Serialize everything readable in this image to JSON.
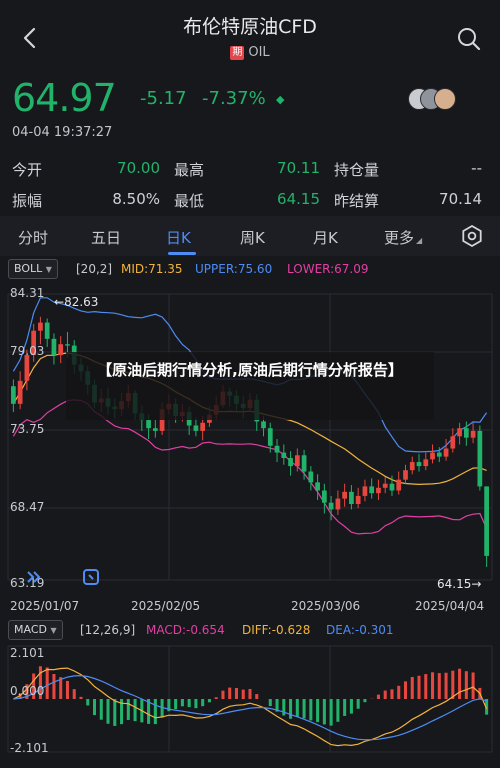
{
  "header": {
    "title": "布伦特原油CFD",
    "badge": "期",
    "subtitle": "OIL"
  },
  "quote": {
    "price": "64.97",
    "change": "-5.17",
    "change_pct": "-7.37%",
    "timestamp": "04-04 19:37:27"
  },
  "stats": [
    {
      "label": "今开",
      "value": "70.00",
      "color": "#21b36a"
    },
    {
      "label": "最高",
      "value": "70.11",
      "color": "#21b36a"
    },
    {
      "label": "持仓量",
      "value": "--",
      "color": "#cfd2d8"
    },
    {
      "label": "振幅",
      "value": "8.50%",
      "color": "#cfd2d8"
    },
    {
      "label": "最低",
      "value": "64.15",
      "color": "#21b36a"
    },
    {
      "label": "昨结算",
      "value": "70.14",
      "color": "#cfd2d8"
    }
  ],
  "tabs": [
    "分时",
    "五日",
    "日K",
    "周K",
    "月K",
    "更多"
  ],
  "boll": {
    "name": "BOLL",
    "params": "[20,2]",
    "mid": "MID:71.35",
    "upper": "UPPER:75.60",
    "lower": "LOWER:67.09"
  },
  "macd": {
    "name": "MACD",
    "params": "[12,26,9]",
    "macd": "MACD:-0.654",
    "diff": "DIFF:-0.628",
    "dea": "DEA:-0.301"
  },
  "price_axis": [
    "84.31",
    "79.03",
    "73.75",
    "68.47",
    "63.19"
  ],
  "macd_axis": [
    "2.101",
    "0.000",
    "-2.101"
  ],
  "price_marks": {
    "high": "82.63",
    "low": "64.15"
  },
  "dates": [
    "2025/01/07",
    "2025/02/05",
    "2025/03/06",
    "2025/04/04"
  ],
  "overlay_text": "【原油后期行情分析,原油后期行情分析报告】",
  "colors": {
    "up": "#e8473f",
    "down": "#21b36a",
    "mid": "#f2b33d",
    "upper": "#4d8cf5",
    "lower": "#e23fa4",
    "accent": "#4d8cf5"
  },
  "chart_data": {
    "type": "candlestick",
    "ylim": [
      63.19,
      84.31
    ],
    "candles": [
      [
        77.5,
        76.2,
        78.0,
        75.6
      ],
      [
        76.2,
        77.9,
        78.6,
        75.8
      ],
      [
        77.9,
        79.8,
        80.2,
        77.2
      ],
      [
        79.8,
        81.6,
        82.1,
        79.3
      ],
      [
        81.6,
        82.2,
        82.63,
        80.6
      ],
      [
        82.2,
        81.0,
        82.5,
        80.4
      ],
      [
        81.0,
        79.8,
        81.4,
        79.1
      ],
      [
        79.8,
        80.6,
        81.2,
        79.2
      ],
      [
        80.6,
        80.5,
        81.5,
        79.6
      ],
      [
        80.5,
        79.1,
        80.9,
        78.4
      ],
      [
        79.1,
        78.6,
        79.6,
        77.9
      ],
      [
        78.6,
        77.6,
        79.0,
        76.9
      ],
      [
        77.6,
        76.3,
        78.0,
        75.9
      ],
      [
        76.3,
        76.6,
        77.3,
        75.6
      ],
      [
        76.6,
        76.0,
        77.4,
        75.4
      ],
      [
        76.0,
        75.8,
        76.6,
        75.1
      ],
      [
        75.8,
        76.4,
        77.0,
        75.3
      ],
      [
        76.4,
        77.0,
        77.6,
        75.9
      ],
      [
        77.0,
        75.5,
        77.2,
        75.0
      ],
      [
        75.5,
        75.0,
        76.1,
        74.2
      ],
      [
        75.0,
        74.4,
        75.4,
        73.6
      ],
      [
        74.4,
        74.2,
        75.0,
        73.7
      ],
      [
        74.2,
        75.8,
        76.3,
        73.9
      ],
      [
        75.8,
        76.2,
        76.9,
        75.4
      ],
      [
        76.2,
        75.3,
        76.6,
        74.8
      ],
      [
        75.3,
        75.6,
        76.2,
        74.9
      ],
      [
        75.6,
        74.6,
        76.0,
        73.9
      ],
      [
        74.6,
        74.2,
        75.2,
        73.8
      ],
      [
        74.2,
        74.8,
        75.3,
        73.5
      ],
      [
        74.8,
        75.4,
        76.0,
        74.5
      ],
      [
        75.4,
        76.1,
        76.8,
        75.0
      ],
      [
        76.1,
        77.1,
        77.6,
        75.9
      ],
      [
        77.1,
        76.8,
        77.4,
        76.0
      ],
      [
        76.8,
        76.2,
        77.2,
        75.7
      ],
      [
        76.2,
        75.9,
        76.8,
        75.1
      ],
      [
        75.9,
        76.5,
        77.0,
        75.6
      ],
      [
        76.5,
        74.9,
        76.9,
        74.2
      ],
      [
        74.9,
        74.4,
        75.3,
        73.8
      ],
      [
        74.4,
        73.1,
        74.8,
        72.6
      ],
      [
        73.1,
        72.6,
        73.6,
        71.9
      ],
      [
        72.6,
        72.2,
        73.2,
        71.7
      ],
      [
        72.2,
        71.6,
        72.7,
        70.9
      ],
      [
        71.6,
        72.4,
        72.9,
        71.2
      ],
      [
        72.4,
        71.2,
        72.8,
        70.6
      ],
      [
        71.2,
        70.4,
        71.6,
        69.8
      ],
      [
        70.4,
        69.8,
        71.0,
        69.1
      ],
      [
        69.8,
        68.9,
        70.3,
        68.1
      ],
      [
        68.9,
        68.4,
        69.4,
        67.6
      ],
      [
        68.4,
        69.2,
        69.8,
        68.0
      ],
      [
        69.2,
        69.7,
        70.3,
        68.6
      ],
      [
        69.7,
        68.8,
        70.2,
        68.4
      ],
      [
        68.8,
        69.4,
        70.0,
        68.5
      ],
      [
        69.4,
        70.1,
        70.6,
        69.0
      ],
      [
        70.1,
        69.6,
        70.7,
        69.2
      ],
      [
        69.6,
        70.0,
        70.6,
        69.1
      ],
      [
        70.0,
        70.3,
        70.8,
        69.6
      ],
      [
        70.3,
        69.8,
        70.9,
        69.4
      ],
      [
        69.8,
        70.6,
        71.2,
        69.5
      ],
      [
        70.6,
        71.3,
        71.7,
        70.3
      ],
      [
        71.3,
        71.9,
        72.3,
        71.0
      ],
      [
        71.9,
        71.6,
        72.5,
        71.2
      ],
      [
        71.6,
        72.1,
        72.6,
        71.3
      ],
      [
        72.1,
        72.6,
        73.2,
        71.8
      ],
      [
        72.6,
        72.3,
        73.0,
        71.9
      ],
      [
        72.3,
        72.9,
        73.6,
        72.0
      ],
      [
        72.9,
        73.8,
        74.4,
        72.6
      ],
      [
        73.8,
        74.4,
        74.8,
        73.2
      ],
      [
        74.4,
        73.7,
        74.9,
        73.1
      ],
      [
        73.7,
        74.2,
        74.8,
        73.3
      ],
      [
        74.2,
        70.1,
        74.6,
        69.8
      ],
      [
        70.1,
        64.97,
        70.11,
        64.15
      ]
    ],
    "macd_range": [
      -2.101,
      2.101
    ]
  }
}
